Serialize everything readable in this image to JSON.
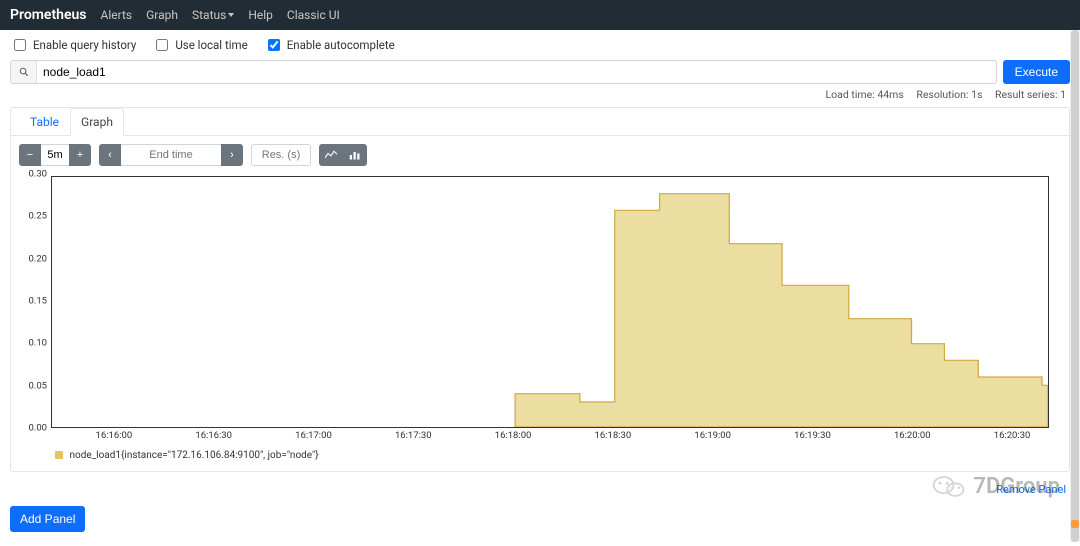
{
  "nav": {
    "brand": "Prometheus",
    "links": [
      "Alerts",
      "Graph",
      "Status",
      "Help",
      "Classic UI"
    ]
  },
  "options": {
    "history": "Enable query history",
    "local_time": "Use local time",
    "autocomplete": "Enable autocomplete"
  },
  "query": {
    "value": "node_load1",
    "execute": "Execute"
  },
  "meta": {
    "load": "Load time: 44ms",
    "res": "Resolution: 1s",
    "series": "Result series: 1"
  },
  "tabs": {
    "table": "Table",
    "graph": "Graph"
  },
  "controls": {
    "range": "5m",
    "end_placeholder": "End time",
    "res_placeholder": "Res. (s)"
  },
  "legend_text": "node_load1{instance=\"172.16.106.84:9100\", job=\"node\"}",
  "remove": "Remove Panel",
  "add": "Add Panel",
  "watermark": "7DGroup",
  "chart_data": {
    "type": "area",
    "title": "",
    "xlabel": "",
    "ylabel": "",
    "ylim": [
      0.0,
      0.3
    ],
    "y_ticks": [
      "0.30",
      "0.25",
      "0.20",
      "0.15",
      "0.10",
      "0.05",
      "0.00"
    ],
    "x_ticks": [
      "16:16:00",
      "16:16:30",
      "16:17:00",
      "16:17:30",
      "16:18:00",
      "16:18:30",
      "16:19:00",
      "16:19:30",
      "16:20:00",
      "16:20:30"
    ],
    "x_frac_start": 0.063,
    "x_frac_step": 0.1,
    "series": [
      {
        "name": "node_load1",
        "color": "#ead996",
        "points": [
          {
            "xf": 0.465,
            "y": 0.04
          },
          {
            "xf": 0.53,
            "y": 0.04
          },
          {
            "xf": 0.53,
            "y": 0.03
          },
          {
            "xf": 0.565,
            "y": 0.03
          },
          {
            "xf": 0.565,
            "y": 0.26
          },
          {
            "xf": 0.61,
            "y": 0.26
          },
          {
            "xf": 0.61,
            "y": 0.28
          },
          {
            "xf": 0.68,
            "y": 0.28
          },
          {
            "xf": 0.68,
            "y": 0.22
          },
          {
            "xf": 0.733,
            "y": 0.22
          },
          {
            "xf": 0.733,
            "y": 0.17
          },
          {
            "xf": 0.8,
            "y": 0.17
          },
          {
            "xf": 0.8,
            "y": 0.13
          },
          {
            "xf": 0.863,
            "y": 0.13
          },
          {
            "xf": 0.863,
            "y": 0.1
          },
          {
            "xf": 0.896,
            "y": 0.1
          },
          {
            "xf": 0.896,
            "y": 0.08
          },
          {
            "xf": 0.93,
            "y": 0.08
          },
          {
            "xf": 0.93,
            "y": 0.06
          },
          {
            "xf": 0.994,
            "y": 0.06
          },
          {
            "xf": 0.994,
            "y": 0.05
          },
          {
            "xf": 1.0,
            "y": 0.05
          }
        ]
      }
    ]
  }
}
